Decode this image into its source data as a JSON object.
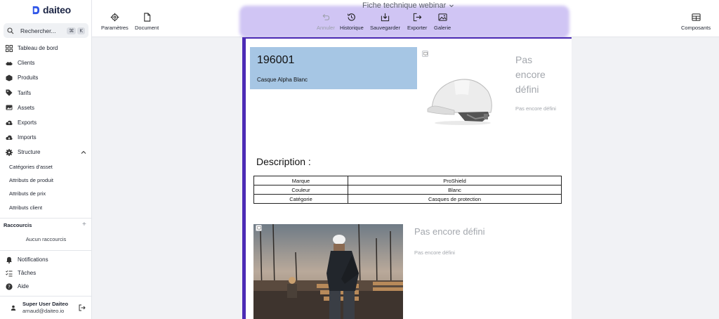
{
  "app": {
    "logo_text": "daiteo"
  },
  "search": {
    "label": "Rechercher...",
    "kbd_1": "⌘",
    "kbd_2": "K"
  },
  "sidebar": {
    "items": [
      {
        "label": "Tableau de bord",
        "icon": "dashboard-icon"
      },
      {
        "label": "Clients",
        "icon": "clients-icon"
      },
      {
        "label": "Produits",
        "icon": "products-icon"
      },
      {
        "label": "Tarifs",
        "icon": "tag-icon"
      },
      {
        "label": "Assets",
        "icon": "assets-icon"
      },
      {
        "label": "Exports",
        "icon": "cloud-upload-icon"
      },
      {
        "label": "Imports",
        "icon": "cloud-download-icon"
      },
      {
        "label": "Structure",
        "icon": "gear-icon",
        "expanded": true
      }
    ],
    "structure_sub": [
      "Catégories d'asset",
      "Attributs de produit",
      "Attributs de prix",
      "Attributs client"
    ],
    "shortcuts_title": "Raccourcis",
    "shortcuts_add": "+",
    "shortcuts_empty": "Aucun raccourcis",
    "bottom": [
      {
        "label": "Notifications",
        "icon": "bell-icon"
      },
      {
        "label": "Tâches",
        "icon": "tasks-icon"
      },
      {
        "label": "Aide",
        "icon": "help-icon"
      }
    ],
    "user": {
      "name": "Super User Daiteo",
      "email": "arnaud@daiteo.io"
    }
  },
  "toolbar": {
    "doc_title": "Fiche technique webinar",
    "parametres": "Paramètres",
    "document": "Document",
    "annuler": "Annuler",
    "historique": "Historique",
    "sauvegarder": "Sauvegarder",
    "exporter": "Exporter",
    "galerie": "Galerie",
    "composants": "Composants"
  },
  "page": {
    "code": "196001",
    "product_name": "Casque Alpha Blanc",
    "placeholder_title": "Pas encore défini",
    "placeholder_text": "Pas encore défini",
    "description_title": "Description :",
    "attributes": [
      {
        "key": "Marque",
        "value": "ProShield"
      },
      {
        "key": "Couleur",
        "value": "Blanc"
      },
      {
        "key": "Catégorie",
        "value": "Casques de protection"
      }
    ],
    "placeholder_title_2": "Pas encore défini",
    "placeholder_text_2": "Pas encore défini"
  },
  "colors": {
    "accent": "#4c2bb5",
    "code_box": "#a6c6e4",
    "placeholder": "#a3a7ad"
  }
}
